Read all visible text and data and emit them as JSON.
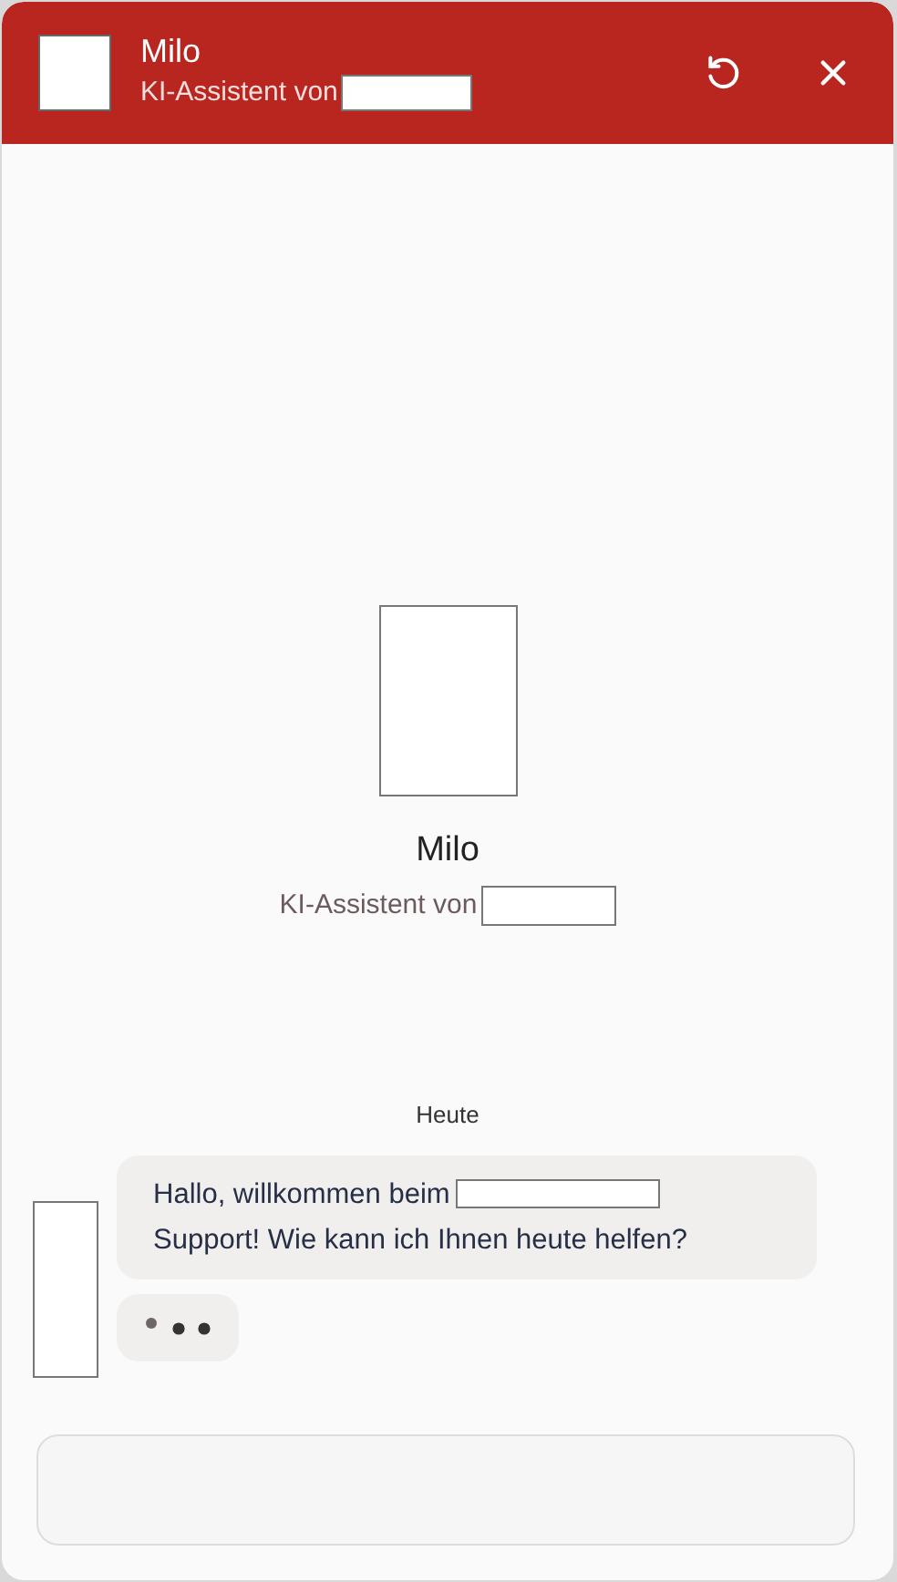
{
  "header": {
    "title": "Milo",
    "subtitle": "KI-Assistent von"
  },
  "intro": {
    "title": "Milo",
    "subtitle": "KI-Assistent von"
  },
  "date_separator": "Heute",
  "messages": [
    {
      "kind": "text",
      "lines": [
        "Hallo, willkommen beim",
        "Support! Wie kann ich Ihnen heute helfen?"
      ]
    },
    {
      "kind": "typing"
    }
  ]
}
